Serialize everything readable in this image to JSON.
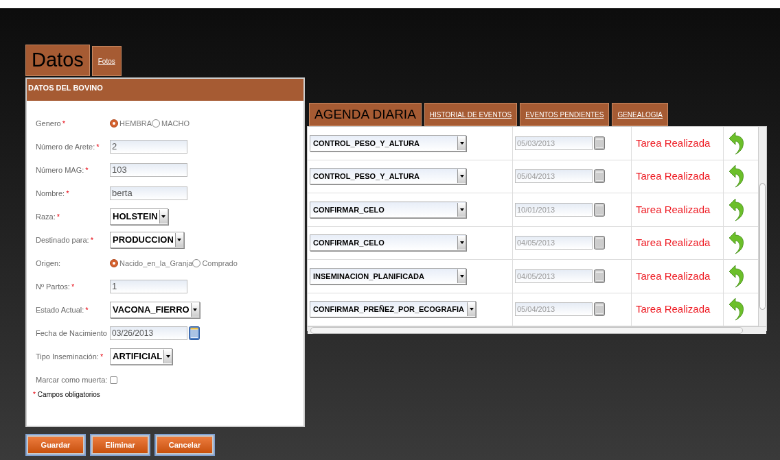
{
  "left_tabs": [
    {
      "label": "Datos",
      "selected": true
    },
    {
      "label": "Fotos",
      "selected": false
    }
  ],
  "section_title": "DATOS DEL BOVINO",
  "fields": [
    {
      "kind": "radio",
      "label": "Genero",
      "required_mark": "*",
      "options": [
        {
          "label": "HEMBRA",
          "selected": true
        },
        {
          "label": "MACHO",
          "selected": false
        }
      ]
    },
    {
      "kind": "text",
      "label": "Número de Arete:",
      "required_mark": "*",
      "value": "2"
    },
    {
      "kind": "text",
      "label": "Número MAG:",
      "required_mark": "*",
      "value": "103"
    },
    {
      "kind": "text",
      "label": "Nombre:",
      "required_mark": "*",
      "value": "berta"
    },
    {
      "kind": "select",
      "label": "Raza:",
      "required_mark": "*",
      "value": "HOLSTEIN"
    },
    {
      "kind": "select",
      "label": "Destinado para:",
      "required_mark": "*",
      "value": "PRODUCCION"
    },
    {
      "kind": "radio",
      "label": "Origen:",
      "options": [
        {
          "label": "Nacido_en_la_Granja",
          "selected": true
        },
        {
          "label": "Comprado",
          "selected": false
        }
      ]
    },
    {
      "kind": "text",
      "label": "Nº Partos:",
      "required_mark": "*",
      "value": "1"
    },
    {
      "kind": "select",
      "label": "Estado Actual:",
      "required_mark": "*",
      "value": "VACONA_FIERRO"
    },
    {
      "kind": "date",
      "label": "Fecha de Nacimiento",
      "value": "03/26/2013"
    },
    {
      "kind": "select",
      "label": "Tipo Inseminación:",
      "required_mark": "*",
      "value": "ARTIFICIAL"
    },
    {
      "kind": "checkbox",
      "label": "Marcar como muerta:",
      "checked": false
    }
  ],
  "required_note": {
    "mark": "*",
    "text": "Campos obligatorios"
  },
  "buttons": [
    "Guardar",
    "Eliminar",
    "Cancelar"
  ],
  "right_tabs": [
    {
      "label": "AGENDA DIARIA",
      "selected": true
    },
    {
      "label": "HISTORIAL DE EVENTOS",
      "selected": false
    },
    {
      "label": "EVENTOS PENDIENTES",
      "selected": false
    },
    {
      "label": "GENEALOGIA",
      "selected": false
    }
  ],
  "tasks": [
    {
      "event": "CONTROL_PESO_Y_ALTURA",
      "date": "05/03/2013",
      "status": "Tarea Realizada"
    },
    {
      "event": "CONTROL_PESO_Y_ALTURA",
      "date": "05/04/2013",
      "status": "Tarea Realizada"
    },
    {
      "event": "CONFIRMAR_CELO",
      "date": "10/01/2013",
      "status": "Tarea Realizada"
    },
    {
      "event": "CONFIRMAR_CELO",
      "date": "04/05/2013",
      "status": "Tarea Realizada"
    },
    {
      "event": "INSEMINACION_PLANIFICADA",
      "date": "04/05/2013",
      "status": "Tarea Realizada"
    },
    {
      "event": "CONFIRMAR_PREÑEZ_POR_ECOGRAFIA",
      "date": "05/04/2013",
      "status": "Tarea Realizada"
    }
  ]
}
